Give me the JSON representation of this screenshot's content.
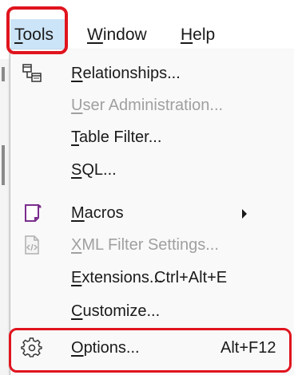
{
  "menubar": {
    "items": [
      {
        "label": "Tools",
        "mnemonic": "T",
        "rest": "ools"
      },
      {
        "label": "Window",
        "mnemonic": "W",
        "rest": "indow"
      },
      {
        "label": "Help",
        "mnemonic": "H",
        "rest": "elp"
      }
    ]
  },
  "menu": {
    "items": [
      {
        "pre": "",
        "mn": "R",
        "post": "elationships...",
        "shortcut": "",
        "enabled": true,
        "icon": "relationships-icon"
      },
      {
        "pre": "",
        "mn": "U",
        "post": "ser Administration...",
        "shortcut": "",
        "enabled": false,
        "icon": ""
      },
      {
        "pre": "",
        "mn": "T",
        "post": "able Filter...",
        "shortcut": "",
        "enabled": true,
        "icon": ""
      },
      {
        "pre": "",
        "mn": "S",
        "post": "QL...",
        "shortcut": "",
        "enabled": true,
        "icon": ""
      },
      {
        "pre": "",
        "mn": "M",
        "post": "acros",
        "shortcut": "",
        "enabled": true,
        "icon": "macros-icon",
        "submenu": true
      },
      {
        "pre": "",
        "mn": "X",
        "post": "ML Filter Settings...",
        "shortcut": "",
        "enabled": false,
        "icon": "xml-filter-icon"
      },
      {
        "pre": "",
        "mn": "E",
        "post": "xtensions...",
        "shortcut": "Ctrl+Alt+E",
        "enabled": true,
        "icon": ""
      },
      {
        "pre": "",
        "mn": "C",
        "post": "ustomize...",
        "shortcut": "",
        "enabled": true,
        "icon": ""
      },
      {
        "pre": "",
        "mn": "O",
        "post": "ptions...",
        "shortcut": "Alt+F12",
        "enabled": true,
        "icon": "options-gear-icon"
      }
    ]
  },
  "colors": {
    "highlight_box": "#e0141e",
    "menu_active_bg": "#cce4f7",
    "disabled_text": "#a0a0a0",
    "macros_icon": "#7a2d8c"
  }
}
